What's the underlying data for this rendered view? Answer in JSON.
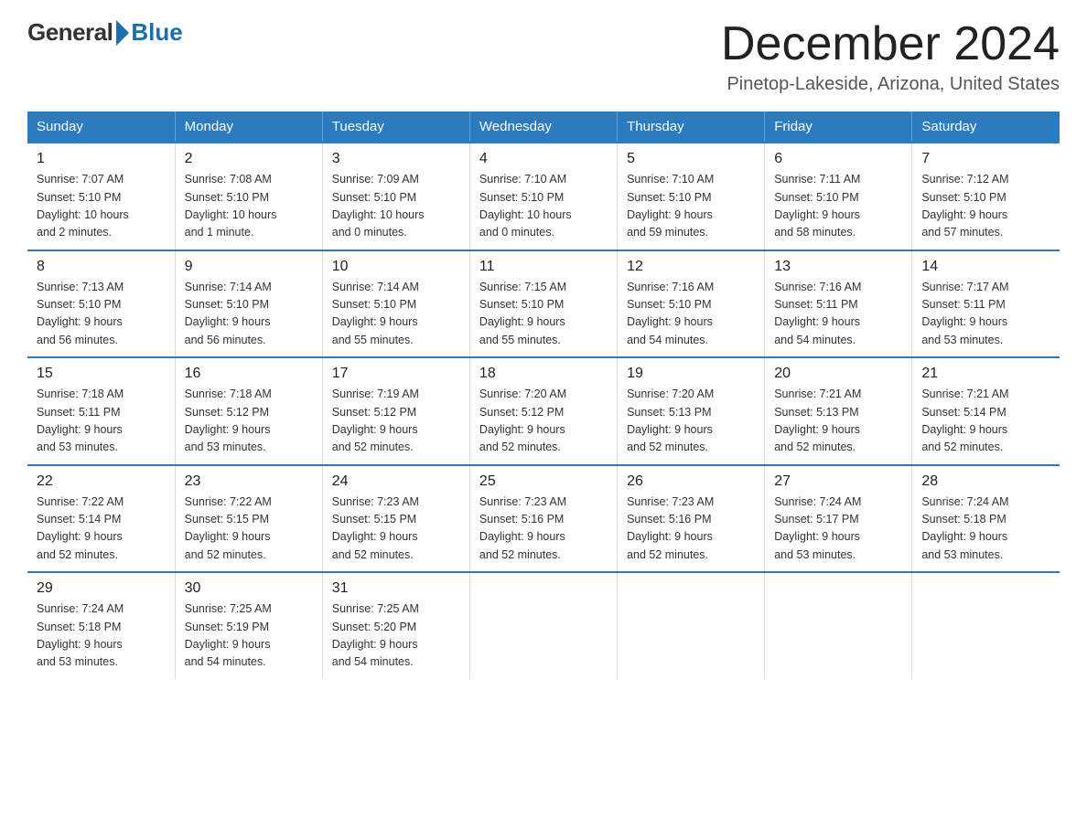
{
  "logo": {
    "general": "General",
    "blue": "Blue"
  },
  "title": "December 2024",
  "subtitle": "Pinetop-Lakeside, Arizona, United States",
  "days": [
    "Sunday",
    "Monday",
    "Tuesday",
    "Wednesday",
    "Thursday",
    "Friday",
    "Saturday"
  ],
  "weeks": [
    [
      {
        "day": "1",
        "sunrise": "7:07 AM",
        "sunset": "5:10 PM",
        "daylight": "10 hours and 2 minutes."
      },
      {
        "day": "2",
        "sunrise": "7:08 AM",
        "sunset": "5:10 PM",
        "daylight": "10 hours and 1 minute."
      },
      {
        "day": "3",
        "sunrise": "7:09 AM",
        "sunset": "5:10 PM",
        "daylight": "10 hours and 0 minutes."
      },
      {
        "day": "4",
        "sunrise": "7:10 AM",
        "sunset": "5:10 PM",
        "daylight": "10 hours and 0 minutes."
      },
      {
        "day": "5",
        "sunrise": "7:10 AM",
        "sunset": "5:10 PM",
        "daylight": "9 hours and 59 minutes."
      },
      {
        "day": "6",
        "sunrise": "7:11 AM",
        "sunset": "5:10 PM",
        "daylight": "9 hours and 58 minutes."
      },
      {
        "day": "7",
        "sunrise": "7:12 AM",
        "sunset": "5:10 PM",
        "daylight": "9 hours and 57 minutes."
      }
    ],
    [
      {
        "day": "8",
        "sunrise": "7:13 AM",
        "sunset": "5:10 PM",
        "daylight": "9 hours and 56 minutes."
      },
      {
        "day": "9",
        "sunrise": "7:14 AM",
        "sunset": "5:10 PM",
        "daylight": "9 hours and 56 minutes."
      },
      {
        "day": "10",
        "sunrise": "7:14 AM",
        "sunset": "5:10 PM",
        "daylight": "9 hours and 55 minutes."
      },
      {
        "day": "11",
        "sunrise": "7:15 AM",
        "sunset": "5:10 PM",
        "daylight": "9 hours and 55 minutes."
      },
      {
        "day": "12",
        "sunrise": "7:16 AM",
        "sunset": "5:10 PM",
        "daylight": "9 hours and 54 minutes."
      },
      {
        "day": "13",
        "sunrise": "7:16 AM",
        "sunset": "5:11 PM",
        "daylight": "9 hours and 54 minutes."
      },
      {
        "day": "14",
        "sunrise": "7:17 AM",
        "sunset": "5:11 PM",
        "daylight": "9 hours and 53 minutes."
      }
    ],
    [
      {
        "day": "15",
        "sunrise": "7:18 AM",
        "sunset": "5:11 PM",
        "daylight": "9 hours and 53 minutes."
      },
      {
        "day": "16",
        "sunrise": "7:18 AM",
        "sunset": "5:12 PM",
        "daylight": "9 hours and 53 minutes."
      },
      {
        "day": "17",
        "sunrise": "7:19 AM",
        "sunset": "5:12 PM",
        "daylight": "9 hours and 52 minutes."
      },
      {
        "day": "18",
        "sunrise": "7:20 AM",
        "sunset": "5:12 PM",
        "daylight": "9 hours and 52 minutes."
      },
      {
        "day": "19",
        "sunrise": "7:20 AM",
        "sunset": "5:13 PM",
        "daylight": "9 hours and 52 minutes."
      },
      {
        "day": "20",
        "sunrise": "7:21 AM",
        "sunset": "5:13 PM",
        "daylight": "9 hours and 52 minutes."
      },
      {
        "day": "21",
        "sunrise": "7:21 AM",
        "sunset": "5:14 PM",
        "daylight": "9 hours and 52 minutes."
      }
    ],
    [
      {
        "day": "22",
        "sunrise": "7:22 AM",
        "sunset": "5:14 PM",
        "daylight": "9 hours and 52 minutes."
      },
      {
        "day": "23",
        "sunrise": "7:22 AM",
        "sunset": "5:15 PM",
        "daylight": "9 hours and 52 minutes."
      },
      {
        "day": "24",
        "sunrise": "7:23 AM",
        "sunset": "5:15 PM",
        "daylight": "9 hours and 52 minutes."
      },
      {
        "day": "25",
        "sunrise": "7:23 AM",
        "sunset": "5:16 PM",
        "daylight": "9 hours and 52 minutes."
      },
      {
        "day": "26",
        "sunrise": "7:23 AM",
        "sunset": "5:16 PM",
        "daylight": "9 hours and 52 minutes."
      },
      {
        "day": "27",
        "sunrise": "7:24 AM",
        "sunset": "5:17 PM",
        "daylight": "9 hours and 53 minutes."
      },
      {
        "day": "28",
        "sunrise": "7:24 AM",
        "sunset": "5:18 PM",
        "daylight": "9 hours and 53 minutes."
      }
    ],
    [
      {
        "day": "29",
        "sunrise": "7:24 AM",
        "sunset": "5:18 PM",
        "daylight": "9 hours and 53 minutes."
      },
      {
        "day": "30",
        "sunrise": "7:25 AM",
        "sunset": "5:19 PM",
        "daylight": "9 hours and 54 minutes."
      },
      {
        "day": "31",
        "sunrise": "7:25 AM",
        "sunset": "5:20 PM",
        "daylight": "9 hours and 54 minutes."
      },
      null,
      null,
      null,
      null
    ]
  ],
  "labels": {
    "sunrise": "Sunrise:",
    "sunset": "Sunset:",
    "daylight": "Daylight:"
  }
}
